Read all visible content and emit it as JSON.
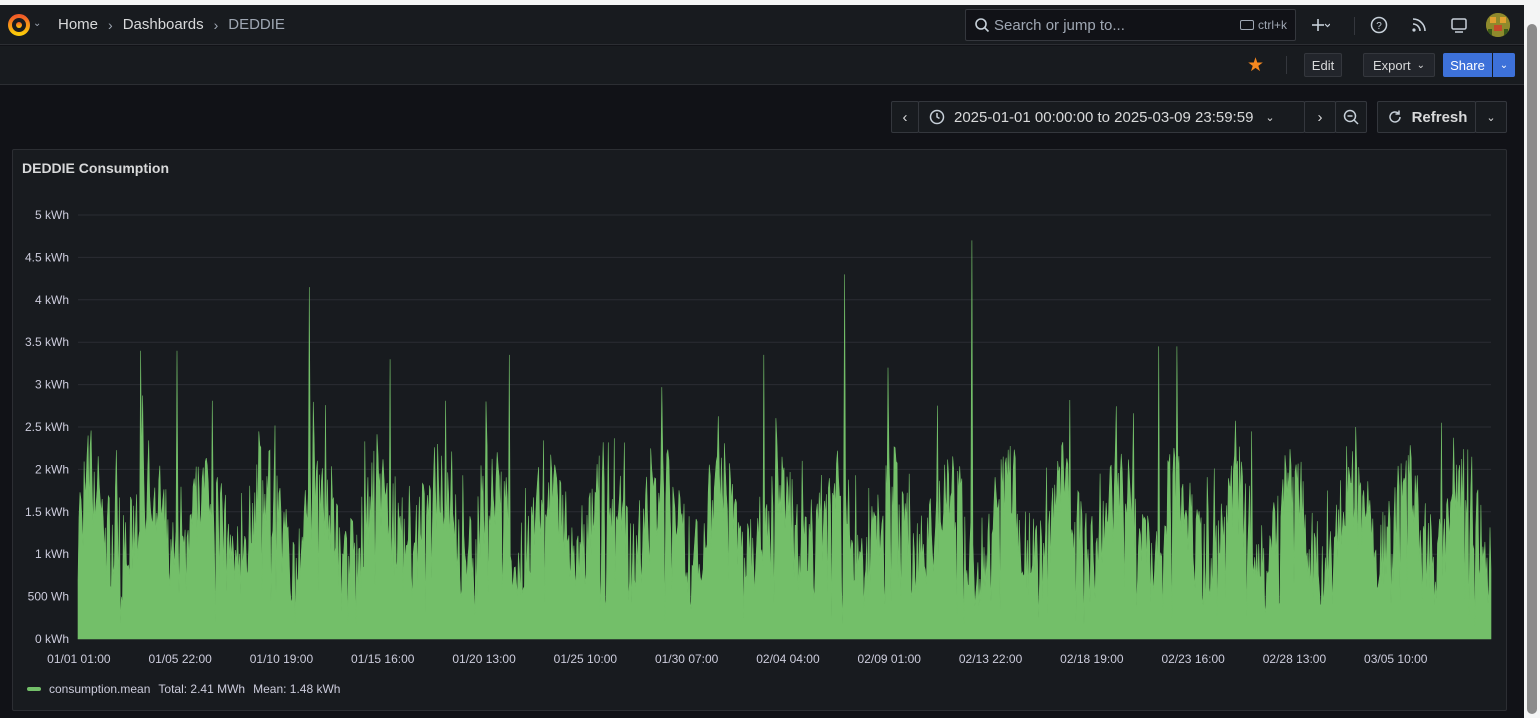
{
  "breadcrumbs": [
    "Home",
    "Dashboards",
    "DEDDIE"
  ],
  "search": {
    "placeholder": "Search or jump to...",
    "shortcut": "ctrl+k"
  },
  "toolbar": {
    "edit_label": "Edit",
    "export_label": "Export",
    "share_label": "Share"
  },
  "timepicker": {
    "range": "2025-01-01 00:00:00 to 2025-03-09 23:59:59",
    "refresh_label": "Refresh"
  },
  "panel": {
    "title": "DEDDIE Consumption"
  },
  "colors": {
    "series": "#73bf69",
    "accent": "#3d71d9",
    "star": "#f5871f"
  },
  "icons": [
    "grafana-logo-icon",
    "search-icon",
    "keyboard-icon",
    "plus-icon",
    "help-icon",
    "rss-icon",
    "kiosk-icon",
    "star-icon",
    "clock-icon",
    "zoom-out-icon",
    "refresh-icon"
  ],
  "chart_data": {
    "type": "area",
    "y_ticks": [
      "0 kWh",
      "500 Wh",
      "1 kWh",
      "1.5 kWh",
      "2 kWh",
      "2.5 kWh",
      "3 kWh",
      "3.5 kWh",
      "4 kWh",
      "4.5 kWh",
      "5 kWh"
    ],
    "ylim": [
      0,
      5
    ],
    "x_ticks": [
      "01/01 01:00",
      "01/05 22:00",
      "01/10 19:00",
      "01/15 16:00",
      "01/20 13:00",
      "01/25 10:00",
      "01/30 07:00",
      "02/04 04:00",
      "02/09 01:00",
      "02/13 22:00",
      "02/18 19:00",
      "02/23 16:00",
      "02/28 13:00",
      "03/05 10:00"
    ],
    "xlim": [
      "2025-01-01 00:00:00",
      "2025-03-09 23:59:59"
    ],
    "grid": true,
    "legend_position": "bottom-left",
    "series": [
      {
        "name": "consumption.mean",
        "total": "Total: 2.41 MWh",
        "mean": "Mean: 1.48 kWh",
        "peaks": [
          {
            "x": "2025-01-01 12:00",
            "y": 2.4
          },
          {
            "x": "2025-01-04 00:00",
            "y": 3.4
          },
          {
            "x": "2025-01-05 18:00",
            "y": 3.4
          },
          {
            "x": "2025-01-12 03:00",
            "y": 4.15
          },
          {
            "x": "2025-01-16 00:00",
            "y": 3.3
          },
          {
            "x": "2025-01-21 18:00",
            "y": 3.35
          },
          {
            "x": "2025-02-03 00:00",
            "y": 3.35
          },
          {
            "x": "2025-02-06 21:00",
            "y": 4.3
          },
          {
            "x": "2025-02-09 00:00",
            "y": 3.2
          },
          {
            "x": "2025-02-13 00:00",
            "y": 4.7
          },
          {
            "x": "2025-02-22 00:00",
            "y": 3.45
          },
          {
            "x": "2025-02-22 21:00",
            "y": 3.45
          },
          {
            "x": "2025-03-03 12:00",
            "y": 2.5
          },
          {
            "x": "2025-03-07 15:00",
            "y": 2.55
          }
        ]
      }
    ]
  }
}
